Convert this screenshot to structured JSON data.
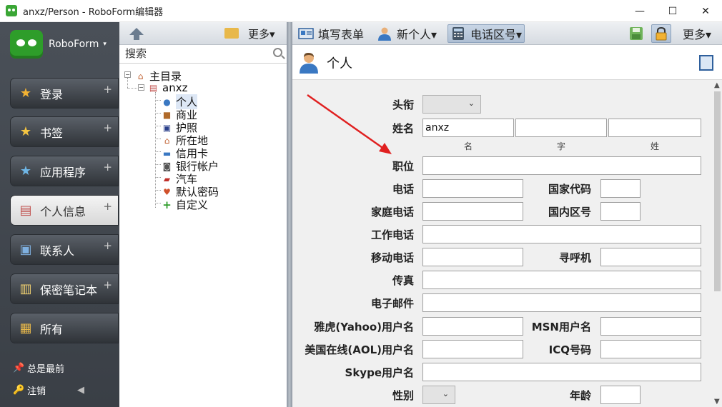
{
  "window": {
    "title": "anxz/Person - RoboForm编辑器",
    "minimize": "—",
    "maximize": "☐",
    "close": "✕"
  },
  "sidebar": {
    "brand": "RoboForm",
    "brand_caret": "▾",
    "items": [
      {
        "label": "登录",
        "icon": "login-star-icon",
        "plus": "+"
      },
      {
        "label": "书签",
        "icon": "bookmark-star-icon",
        "plus": "+"
      },
      {
        "label": "应用程序",
        "icon": "apps-star-icon",
        "plus": "+"
      },
      {
        "label": "个人信息",
        "icon": "identity-card-icon",
        "plus": "+"
      },
      {
        "label": "联系人",
        "icon": "contact-card-icon",
        "plus": "+"
      },
      {
        "label": "保密笔记本",
        "icon": "notepad-icon",
        "plus": "+"
      },
      {
        "label": "所有",
        "icon": "all-items-icon",
        "plus": ""
      }
    ],
    "pin_label": "总是最前",
    "logout_label": "注销"
  },
  "tree_panel": {
    "more_label": "更多▾",
    "search_placeholder": "搜索",
    "root": "主目录",
    "identity": "anxz",
    "children": [
      "个人",
      "商业",
      "护照",
      "所在地",
      "信用卡",
      "银行帐户",
      "汽车",
      "默认密码",
      "自定义"
    ]
  },
  "main_toolbar": {
    "fill_form": "填写表单",
    "new_person": "新个人▾",
    "area_code": "电话区号▾",
    "more": "更多▾"
  },
  "form": {
    "section_title": "个人",
    "labels": {
      "title": "头衔",
      "name": "姓名",
      "job": "职位",
      "phone": "电话",
      "country_code": "国家代码",
      "home_phone": "家庭电话",
      "area_code": "国内区号",
      "work_phone": "工作电话",
      "mobile": "移动电话",
      "pager": "寻呼机",
      "fax": "传真",
      "email": "电子邮件",
      "yahoo": "雅虎(Yahoo)用户名",
      "msn": "MSN用户名",
      "aol": "美国在线(AOL)用户名",
      "icq": "ICQ号码",
      "skype": "Skype用户名",
      "gender": "性别",
      "age": "年龄"
    },
    "name_parts": {
      "first": "名",
      "middle": "字",
      "last": "姓"
    },
    "values": {
      "first_name": "anxz"
    }
  },
  "colors": {
    "sidebar_bg": "#3f444b",
    "accent_blue": "#2e5f9c",
    "arrow_red": "#e02020"
  }
}
